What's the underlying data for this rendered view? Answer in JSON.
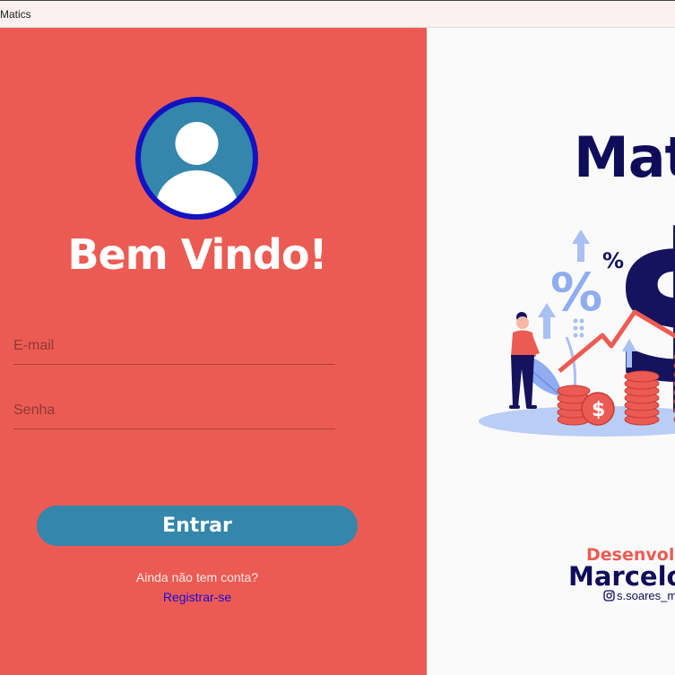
{
  "window": {
    "title": "Matics"
  },
  "login": {
    "welcome": "Bem Vindo!",
    "email_placeholder": "E-mail",
    "password_placeholder": "Senha",
    "login_button": "Entrar",
    "no_account_text": "Ainda não tem conta?",
    "register_link": "Registrar-se"
  },
  "brand": {
    "name": "Matics",
    "developed_by_label": "Desenvolvido por",
    "developer_name": "Marcelo Soares",
    "instagram_handle": "s.soares_m"
  },
  "icons": {
    "avatar": "user-avatar-icon",
    "instagram": "instagram-icon",
    "illustration": "finance-illustration"
  },
  "colors": {
    "left_panel": "#ec5b53",
    "accent_blue": "#3486ab",
    "avatar_ring": "#1412c2",
    "brand_navy": "#0f0c5a",
    "link": "#1b0bd8"
  }
}
